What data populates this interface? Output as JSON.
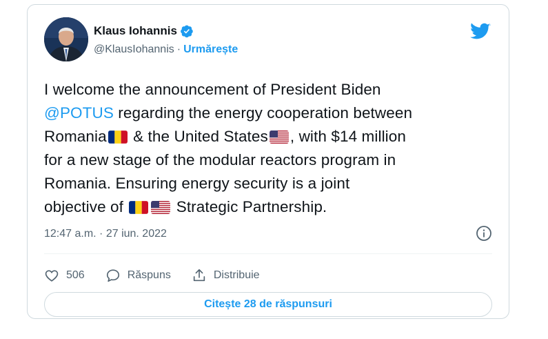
{
  "author": {
    "name": "Klaus Iohannis",
    "handle": "@KlausIohannis",
    "separator": "·",
    "follow_label": "Urmărește"
  },
  "tweet": {
    "line1": "I welcome the announcement of President Biden",
    "mention": "@POTUS",
    "line2_rest": " regarding the energy cooperation between",
    "line3_a": "Romania",
    "line3_b": " & the United States",
    "line3_c": ", with $14 million",
    "line4": "for a new stage of the modular reactors program in",
    "line5": "Romania. Ensuring energy security is a joint",
    "line6_a": "objective of ",
    "line6_b": " Strategic Partnership."
  },
  "timestamp": "12:47 a.m. · 27 iun. 2022",
  "actions": {
    "likes": "506",
    "reply_label": "Răspuns",
    "share_label": "Distribuie"
  },
  "read_replies_label": "Citește 28 de răspunsuri",
  "colors": {
    "accent": "#1d9bf0",
    "text": "#0f1419",
    "muted": "#536471",
    "border": "#cfd9de"
  },
  "icons": [
    "verified-badge-icon",
    "twitter-bird-icon",
    "info-icon",
    "heart-icon",
    "reply-icon",
    "share-icon",
    "romania-flag-icon",
    "us-flag-icon"
  ]
}
